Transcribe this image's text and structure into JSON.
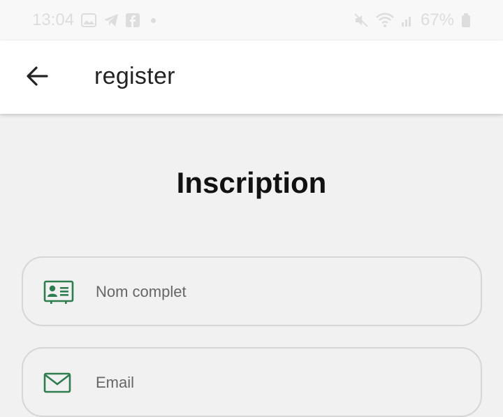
{
  "status_bar": {
    "time": "13:04",
    "battery": "67%"
  },
  "app_bar": {
    "back_icon": "arrow-left-icon",
    "title": "register"
  },
  "form": {
    "heading": "Inscription",
    "full_name": {
      "placeholder": "Nom complet",
      "icon": "id-card-icon",
      "value": ""
    },
    "email": {
      "placeholder": "Email",
      "icon": "mail-icon",
      "value": ""
    }
  },
  "colors": {
    "accent_green": "#2e7d4f",
    "background": "#f1f1f1",
    "field_border": "#d6d6d6"
  }
}
